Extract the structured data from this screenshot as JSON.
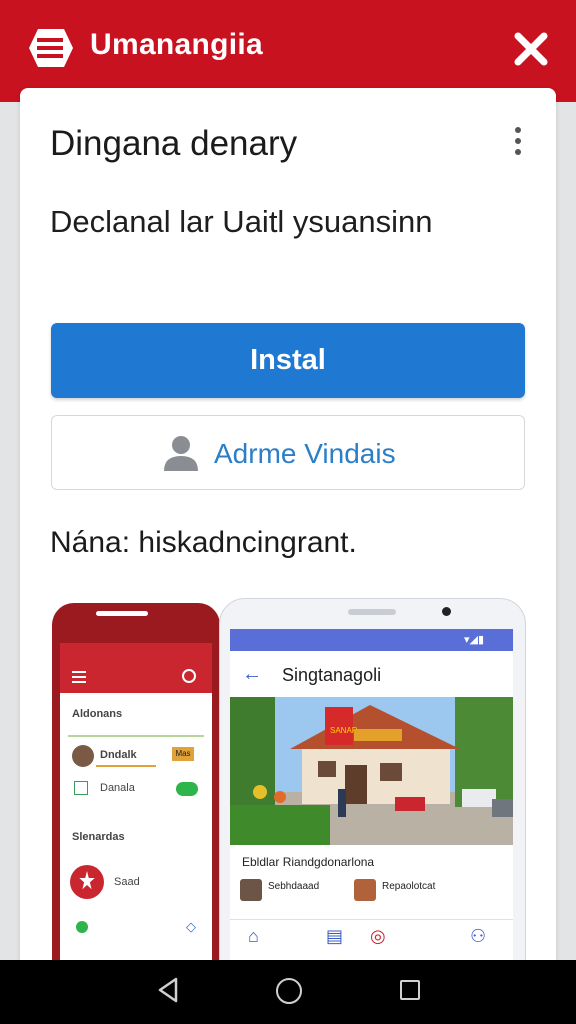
{
  "colors": {
    "brand": "#c8121f",
    "primary_button": "#1f78d1",
    "link": "#2b7ec8"
  },
  "header": {
    "app_title": "Umanangiia",
    "logo_icon": "stacked-lines-icon",
    "close_icon": "close-icon"
  },
  "dialog": {
    "title": "Dingana denary",
    "subtitle": "Declanal lar Uaitl ysuansinn",
    "install_label": "Instal",
    "admin_label": "Adrme Vindais",
    "name_line": "Nána: hiskadncingrant."
  },
  "left_phone": {
    "section1": "Aldonans",
    "row1": "Dndalk",
    "row1_badge": "Mas",
    "row2": "Danala",
    "section2": "Slenardas",
    "row3": "Saad"
  },
  "right_phone": {
    "title": "Singtanagoli",
    "caption": "Ebldlar Riandgdonarlona",
    "chip1": "Sebhdaaad",
    "chip2": "Repaolotcat",
    "photo_banner": "SANAR"
  },
  "system_nav": {
    "back_icon": "back-triangle-icon",
    "home_icon": "home-circle-icon",
    "recent_icon": "recent-square-icon"
  }
}
